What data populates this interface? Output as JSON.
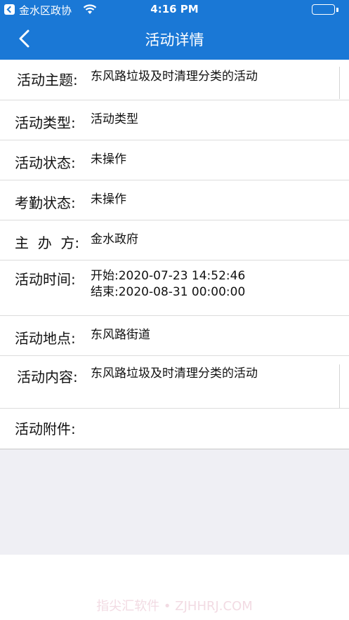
{
  "status_bar": {
    "carrier": "金水区政协",
    "time": "4:16 PM",
    "battery_color": "#4cd964"
  },
  "nav": {
    "title": "活动详情",
    "back_icon": "chevron-left-icon"
  },
  "details": [
    {
      "label": "活动主题:",
      "value": "东风路垃圾及时清理分类的活动"
    },
    {
      "label": "活动类型:",
      "value": "活动类型"
    },
    {
      "label": "活动状态:",
      "value": "未操作"
    },
    {
      "label": "考勤状态:",
      "value": "未操作"
    },
    {
      "label": "主  办  方:",
      "value": "金水政府"
    },
    {
      "label": "活动时间:",
      "value": "开始:2020-07-23 14:52:46",
      "value2": "结束:2020-08-31 00:00:00"
    },
    {
      "label": "活动地点:",
      "value": "东风路街道"
    },
    {
      "label": "活动内容:",
      "value": "东风路垃圾及时清理分类的活动"
    },
    {
      "label": "活动附件:",
      "value": ""
    }
  ],
  "watermark": "指尖汇软件 • ZJHHRJ.COM",
  "colors": {
    "header_blue": "#1a78d6",
    "background_gray": "#efeff4"
  }
}
